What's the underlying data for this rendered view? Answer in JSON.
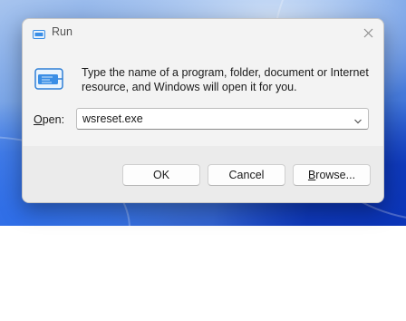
{
  "window": {
    "title": "Run",
    "close_icon": "close-icon",
    "app_icon": "run-icon"
  },
  "dialog": {
    "description": "Type the name of a program, folder, document or Internet resource, and Windows will open it for you.",
    "open_label_accel": "O",
    "open_label_rest": "pen:",
    "open_value": "wsreset.exe",
    "dropdown_icon": "chevron-down-icon"
  },
  "buttons": {
    "ok": "OK",
    "cancel": "Cancel",
    "browse_accel": "B",
    "browse_rest": "rowse..."
  },
  "colors": {
    "dialog_bg": "#f3f3f3",
    "footer_bg": "#ebebeb",
    "icon_accent": "#3a8ee6"
  }
}
